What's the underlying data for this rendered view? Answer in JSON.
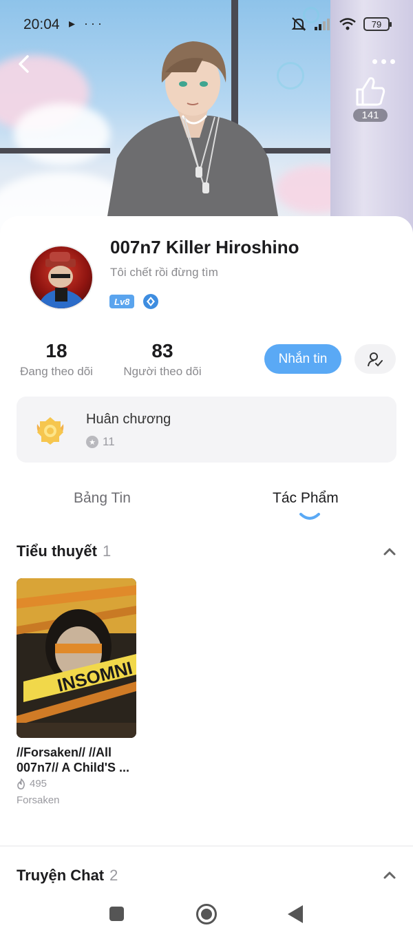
{
  "status_bar": {
    "time": "20:04",
    "left_icons": "▸ ···",
    "battery": "79"
  },
  "hero": {
    "like_count": "141"
  },
  "profile": {
    "username": "007n7 Killer Hiroshino",
    "bio": "Tôi chết rồi đừng tìm",
    "level": "Lv8"
  },
  "stats": {
    "following_count": "18",
    "following_label": "Đang theo dõi",
    "followers_count": "83",
    "followers_label": "Người theo dõi"
  },
  "actions": {
    "message_label": "Nhắn tin"
  },
  "medal": {
    "title": "Huân chương",
    "count": "11"
  },
  "tabs": [
    {
      "label": "Bảng Tin",
      "active": false
    },
    {
      "label": "Tác Phẩm",
      "active": true
    }
  ],
  "sections": {
    "novels": {
      "title": "Tiểu thuyết",
      "count": "1",
      "items": [
        {
          "title": "//Forsaken// //All 007n7// A Child'S ...",
          "views": "495",
          "tag": "Forsaken",
          "cover_text": "INSOMNI"
        }
      ]
    },
    "chat_stories": {
      "title": "Truyện Chat",
      "count": "2"
    }
  },
  "colors": {
    "accent": "#5aa9f5",
    "level_badge": "#5aa4ee",
    "text_primary": "#1c1c1e",
    "text_secondary": "#8a8a8e"
  }
}
